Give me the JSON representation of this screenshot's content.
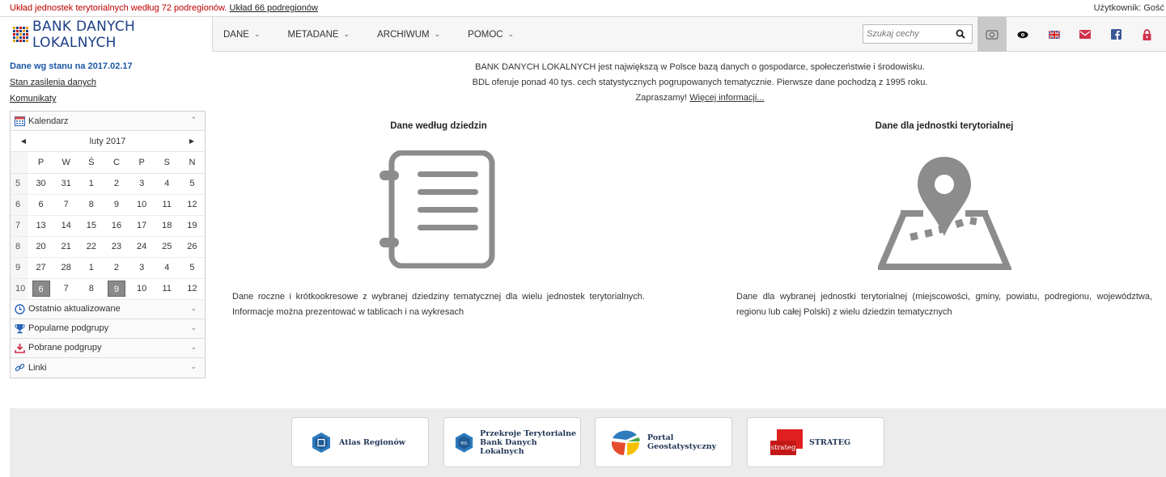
{
  "topbar": {
    "notice": "Układ jednostek terytorialnych według 72 podregionów.",
    "alt_link": "Układ 66 podregionów",
    "user": "Użytkownik: Gość"
  },
  "nav": {
    "logo_text": "BANK DANYCH LOKALNYCH",
    "menu": [
      {
        "label": "DANE"
      },
      {
        "label": "METADANE"
      },
      {
        "label": "ARCHIWUM"
      },
      {
        "label": "POMOC"
      }
    ],
    "search_placeholder": "Szukaj cechy"
  },
  "left": {
    "date_status": "Dane wg stanu na 2017.02.17",
    "link_supply": "Stan zasilenia danych",
    "link_messages": "Komunikaty",
    "calendar": {
      "title": "Kalendarz",
      "month": "luty 2017",
      "weekdays": [
        "P",
        "W",
        "Ś",
        "C",
        "P",
        "S",
        "N"
      ],
      "weeks": [
        {
          "wk": "5",
          "days": [
            "30",
            "31",
            "1",
            "2",
            "3",
            "4",
            "5"
          ]
        },
        {
          "wk": "6",
          "days": [
            "6",
            "7",
            "8",
            "9",
            "10",
            "11",
            "12"
          ]
        },
        {
          "wk": "7",
          "days": [
            "13",
            "14",
            "15",
            "16",
            "17",
            "18",
            "19"
          ]
        },
        {
          "wk": "8",
          "days": [
            "20",
            "21",
            "22",
            "23",
            "24",
            "25",
            "26"
          ]
        },
        {
          "wk": "9",
          "days": [
            "27",
            "28",
            "1",
            "2",
            "3",
            "4",
            "5"
          ]
        },
        {
          "wk": "10",
          "days": [
            "6",
            "7",
            "8",
            "9",
            "10",
            "11",
            "12"
          ]
        }
      ],
      "highlighted": [
        [
          5,
          0
        ],
        [
          5,
          3
        ]
      ]
    },
    "sections": [
      {
        "label": "Ostatnio aktualizowane",
        "icon": "clock-icon"
      },
      {
        "label": "Popularne podgrupy",
        "icon": "trophy-icon"
      },
      {
        "label": "Pobrane podgrupy",
        "icon": "download-icon"
      },
      {
        "label": "Linki",
        "icon": "link-icon"
      }
    ]
  },
  "intro": {
    "line1": "BANK DANYCH LOKALNYCH jest największą w Polsce bazą danych o gospodarce, społeczeństwie i środowisku.",
    "line2": "BDL oferuje ponad 40 tys. cech statystycznych pogrupowanych tematycznie. Pierwsze dane pochodzą z 1995 roku.",
    "line3_prefix": "Zapraszamy! ",
    "line3_link": "Więcej informacji..."
  },
  "col_domains": {
    "title": "Dane według dziedzin",
    "desc": "Dane roczne i krótkookresowe z wybranej dziedziny tematycznej dla wielu jednostek terytorialnych. Informacje można prezentować w tablicach i na wykresach"
  },
  "col_unit": {
    "title": "Dane dla jednostki terytorialnej",
    "desc": "Dane dla wybranej jednostki terytorialnej (miejscowości, gminy, powiatu, podregionu, województwa, regionu lub całej Polski) z wielu dziedzin tematycznych"
  },
  "footer": {
    "atlas": "Atlas Regionów",
    "przekroje_1": "Przekroje Terytorialne",
    "przekroje_2": "Bank Danych Lokalnych",
    "bdl_badge": "BDL",
    "portal_1": "Portal",
    "portal_2": "Geostatystyczny",
    "strateg_badge": "strateg",
    "strateg": "STRATEG"
  },
  "colors": {
    "brand_blue": "#1d3f86",
    "notice_red": "#c00000",
    "date_blue": "#1a58a8",
    "icon_gray": "#8c8c8c"
  }
}
